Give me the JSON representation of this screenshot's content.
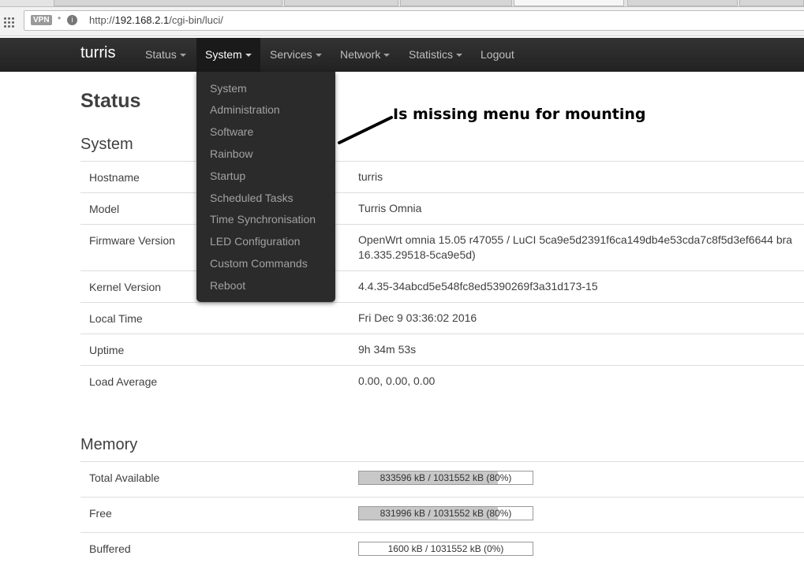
{
  "browser": {
    "vpn_label": "VPN",
    "url_prefix": "http://",
    "url_host": "192.168.2.1",
    "url_path": "/cgi-bin/luci/"
  },
  "nav": {
    "brand": "turris",
    "items": [
      {
        "label": "Status",
        "caret": true
      },
      {
        "label": "System",
        "caret": true
      },
      {
        "label": "Services",
        "caret": true
      },
      {
        "label": "Network",
        "caret": true
      },
      {
        "label": "Statistics",
        "caret": true
      },
      {
        "label": "Logout",
        "caret": false
      }
    ]
  },
  "system_menu": {
    "items": [
      "System",
      "Administration",
      "Software",
      "Rainbow",
      "Startup",
      "Scheduled Tasks",
      "Time Synchronisation",
      "LED Configuration",
      "Custom Commands",
      "Reboot"
    ]
  },
  "annotation": {
    "text": "Is missing menu for mounting"
  },
  "page": {
    "title": "Status",
    "system_section": {
      "heading": "System",
      "rows": [
        {
          "label": "Hostname",
          "value": "turris"
        },
        {
          "label": "Model",
          "value": "Turris Omnia"
        },
        {
          "label": "Firmware Version",
          "value": "OpenWrt omnia 15.05 r47055 / LuCI 5ca9e5d2391f6ca149db4e53cda7c8f5d3ef6644 bra",
          "value2": "16.335.29518-5ca9e5d)"
        },
        {
          "label": "Kernel Version",
          "value": "4.4.35-34abcd5e548fc8ed5390269f3a31d173-15"
        },
        {
          "label": "Local Time",
          "value": "Fri Dec 9 03:36:02 2016"
        },
        {
          "label": "Uptime",
          "value": "9h 34m 53s"
        },
        {
          "label": "Load Average",
          "value": "0.00, 0.00, 0.00"
        }
      ]
    },
    "memory_section": {
      "heading": "Memory",
      "rows": [
        {
          "label": "Total Available",
          "text": "833596 kB / 1031552 kB (80%)",
          "fraction": 0.8
        },
        {
          "label": "Free",
          "text": "831996 kB / 1031552 kB (80%)",
          "fraction": 0.8
        },
        {
          "label": "Buffered",
          "text": "1600 kB / 1031552 kB (0%)",
          "fraction": 0.0
        }
      ]
    }
  },
  "colors": {
    "navbar": "#2c2c2c",
    "progress_fill": "#c8c8c8"
  }
}
